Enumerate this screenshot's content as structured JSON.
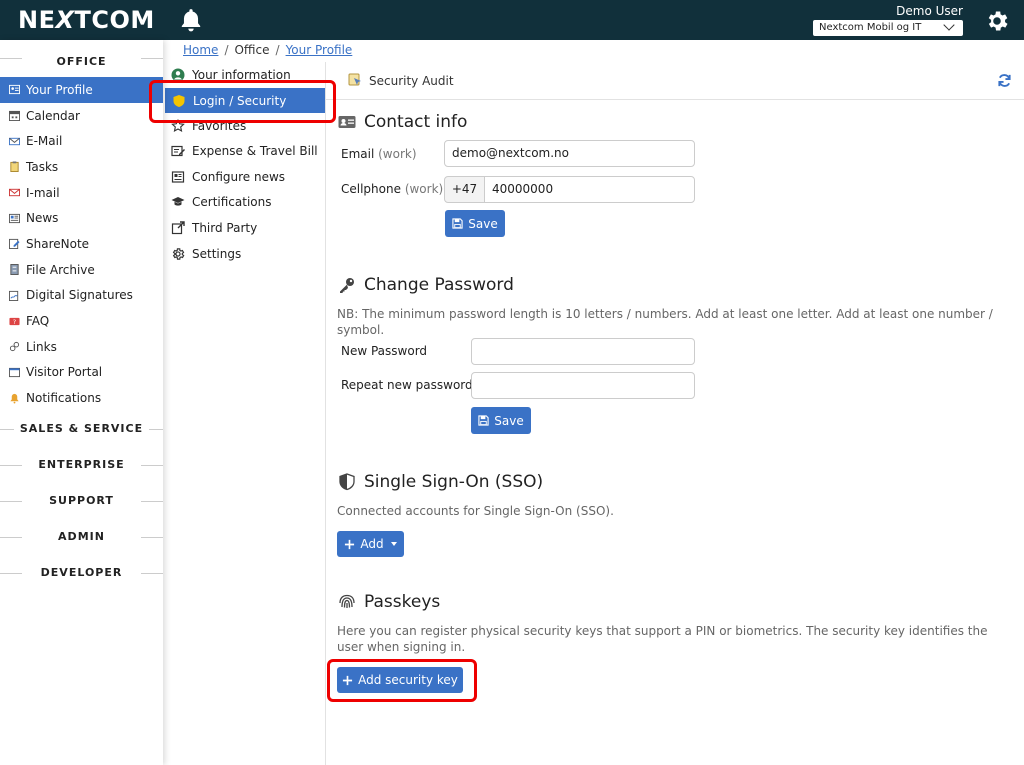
{
  "header": {
    "logo_left": "NE",
    "logo_x": "X",
    "logo_right": "TCOM",
    "user_name": "Demo User",
    "company": "Nextcom Mobil og IT"
  },
  "breadcrumb": {
    "home": "Home",
    "office": "Office",
    "current": "Your Profile"
  },
  "leftnav": {
    "office_heading": "OFFICE",
    "items": [
      {
        "label": "Your Profile"
      },
      {
        "label": "Calendar"
      },
      {
        "label": "E-Mail"
      },
      {
        "label": "Tasks"
      },
      {
        "label": "I-mail"
      },
      {
        "label": "News"
      },
      {
        "label": "ShareNote"
      },
      {
        "label": "File Archive"
      },
      {
        "label": "Digital Signatures"
      },
      {
        "label": "FAQ"
      },
      {
        "label": "Links"
      },
      {
        "label": "Visitor Portal"
      },
      {
        "label": "Notifications"
      }
    ],
    "sections": [
      "SALES & SERVICE",
      "ENTERPRISE",
      "SUPPORT",
      "ADMIN",
      "DEVELOPER"
    ]
  },
  "subnav": {
    "items": [
      {
        "label": "Your information"
      },
      {
        "label": "Login / Security"
      },
      {
        "label": "Favorites"
      },
      {
        "label": "Expense & Travel Bill"
      },
      {
        "label": "Configure news"
      },
      {
        "label": "Certifications"
      },
      {
        "label": "Third Party"
      },
      {
        "label": "Settings"
      }
    ]
  },
  "main": {
    "audit_label": "Security Audit",
    "contact": {
      "title": "Contact info",
      "email_label": "Email",
      "email_hint": "(work)",
      "email_value": "demo@nextcom.no",
      "cell_label": "Cellphone",
      "cell_hint": "(work)",
      "cell_prefix": "+47",
      "cell_value": "40000000",
      "save": "Save"
    },
    "password": {
      "title": "Change Password",
      "note": "NB: The minimum password length is 10 letters / numbers. Add at least one letter. Add at least one number / symbol.",
      "new_label": "New Password",
      "repeat_label": "Repeat new password",
      "save": "Save"
    },
    "sso": {
      "title": "Single Sign-On (SSO)",
      "desc": "Connected accounts for Single Sign-On (SSO).",
      "add": "Add"
    },
    "passkeys": {
      "title": "Passkeys",
      "desc": "Here you can register physical security keys that support a PIN or biometrics. The security key identifies the user when signing in.",
      "add": "Add security key"
    }
  },
  "colors": {
    "topbar": "#11303b",
    "accent": "#3a72c6",
    "highlight": "#e00000"
  }
}
